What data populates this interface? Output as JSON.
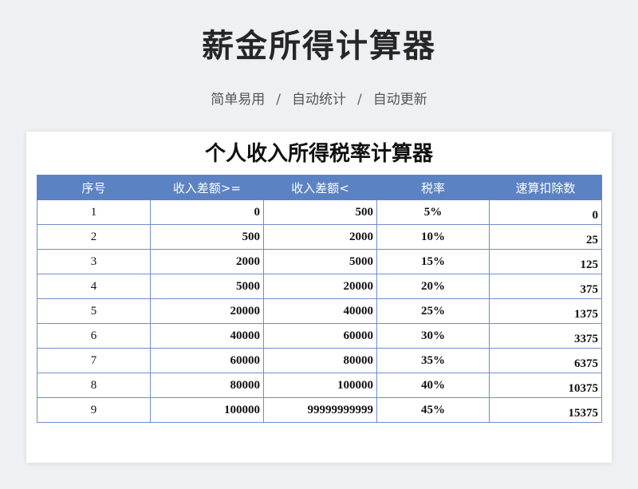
{
  "header": {
    "title": "薪金所得计算器",
    "features": [
      "简单易用",
      "自动统计",
      "自动更新"
    ],
    "separator": "/"
  },
  "sheet": {
    "title": "个人收入所得税率计算器",
    "columns": [
      "序号",
      "收入差额>=",
      "收入差额<",
      "税率",
      "速算扣除数"
    ],
    "rows": [
      [
        "1",
        "0",
        "500",
        "5%",
        "0"
      ],
      [
        "2",
        "500",
        "2000",
        "10%",
        "25"
      ],
      [
        "3",
        "2000",
        "5000",
        "15%",
        "125"
      ],
      [
        "4",
        "5000",
        "20000",
        "20%",
        "375"
      ],
      [
        "5",
        "20000",
        "40000",
        "25%",
        "1375"
      ],
      [
        "6",
        "40000",
        "60000",
        "30%",
        "3375"
      ],
      [
        "7",
        "60000",
        "80000",
        "35%",
        "6375"
      ],
      [
        "8",
        "80000",
        "100000",
        "40%",
        "10375"
      ],
      [
        "9",
        "100000",
        "99999999999",
        "45%",
        "15375"
      ]
    ]
  },
  "colors": {
    "header_bg": "#5b82c3",
    "grid_border": "#6d8fc9",
    "page_bg": "#eef0f4"
  }
}
